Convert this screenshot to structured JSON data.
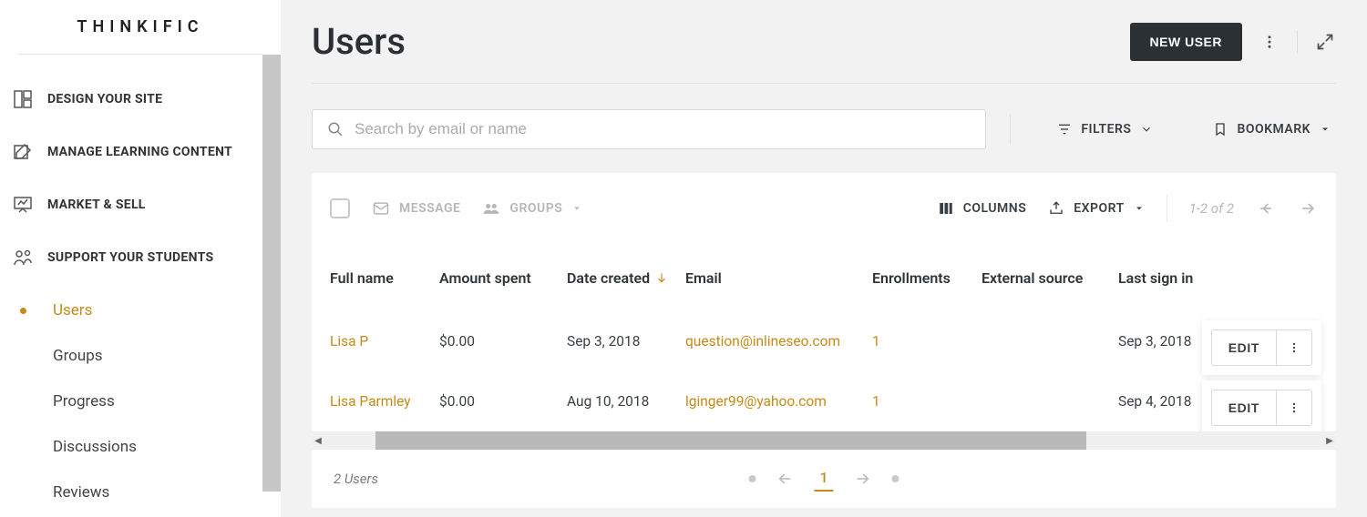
{
  "brand": "THINKIFIC",
  "sidebar": {
    "items": [
      {
        "label": "DESIGN YOUR SITE"
      },
      {
        "label": "MANAGE LEARNING CONTENT"
      },
      {
        "label": "MARKET & SELL"
      },
      {
        "label": "SUPPORT YOUR STUDENTS"
      }
    ],
    "subitems": [
      {
        "label": "Users",
        "active": true
      },
      {
        "label": "Groups"
      },
      {
        "label": "Progress"
      },
      {
        "label": "Discussions"
      },
      {
        "label": "Reviews"
      }
    ]
  },
  "header": {
    "title": "Users",
    "new_user": "NEW USER"
  },
  "search": {
    "placeholder": "Search by email or name",
    "filters": "FILTERS",
    "bookmark": "BOOKMARK"
  },
  "toolbar": {
    "message": "MESSAGE",
    "groups": "GROUPS",
    "columns": "COLUMNS",
    "export": "EXPORT",
    "page_info": "1-2 of 2"
  },
  "table": {
    "columns": [
      "Full name",
      "Amount spent",
      "Date created",
      "Email",
      "Enrollments",
      "External source",
      "Last sign in"
    ],
    "sort_index": 2,
    "edit_label": "EDIT",
    "rows": [
      {
        "name": "Lisa P",
        "amount": "$0.00",
        "created": "Sep 3, 2018",
        "email": "question@inlineseo.com",
        "enrollments": "1",
        "external": "",
        "last_signin": "Sep 3, 2018"
      },
      {
        "name": "Lisa Parmley",
        "amount": "$0.00",
        "created": "Aug 10, 2018",
        "email": "lginger99@yahoo.com",
        "enrollments": "1",
        "external": "",
        "last_signin": "Sep 4, 2018"
      }
    ]
  },
  "footer": {
    "count": "2 Users",
    "page": "1"
  }
}
